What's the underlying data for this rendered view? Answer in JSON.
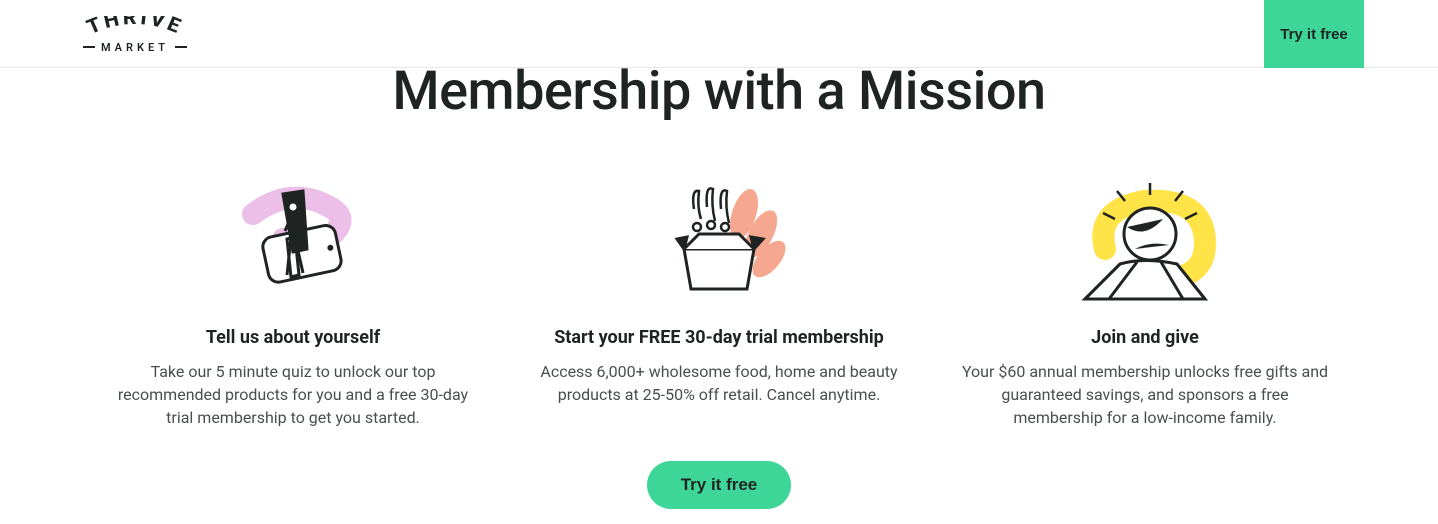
{
  "brand": {
    "top": "THRIVE",
    "bottom": "MARKET"
  },
  "header": {
    "cta_label": "Try it free"
  },
  "headline": "Membership with a Mission",
  "columns": [
    {
      "icon": "quiz-phone-icon",
      "title": "Tell us about yourself",
      "body": "Take our 5 minute quiz to unlock our top recommended products for you and a free 30-day trial membership to get you started."
    },
    {
      "icon": "box-produce-icon",
      "title": "Start your FREE 30-day trial membership",
      "body": "Access 6,000+ wholesome food, home and beauty products at 25-50% off retail. Cancel anytime."
    },
    {
      "icon": "globe-hands-icon",
      "title": "Join and give",
      "body": "Your $60 annual membership unlocks free gifts and guaranteed savings, and sponsors a free membership for a low-income family."
    }
  ],
  "cta": {
    "label": "Try it free"
  },
  "colors": {
    "accent": "#3dd598",
    "pink": "#e9b8e6",
    "peach": "#f5a48a",
    "yellow": "#ffe23d"
  }
}
